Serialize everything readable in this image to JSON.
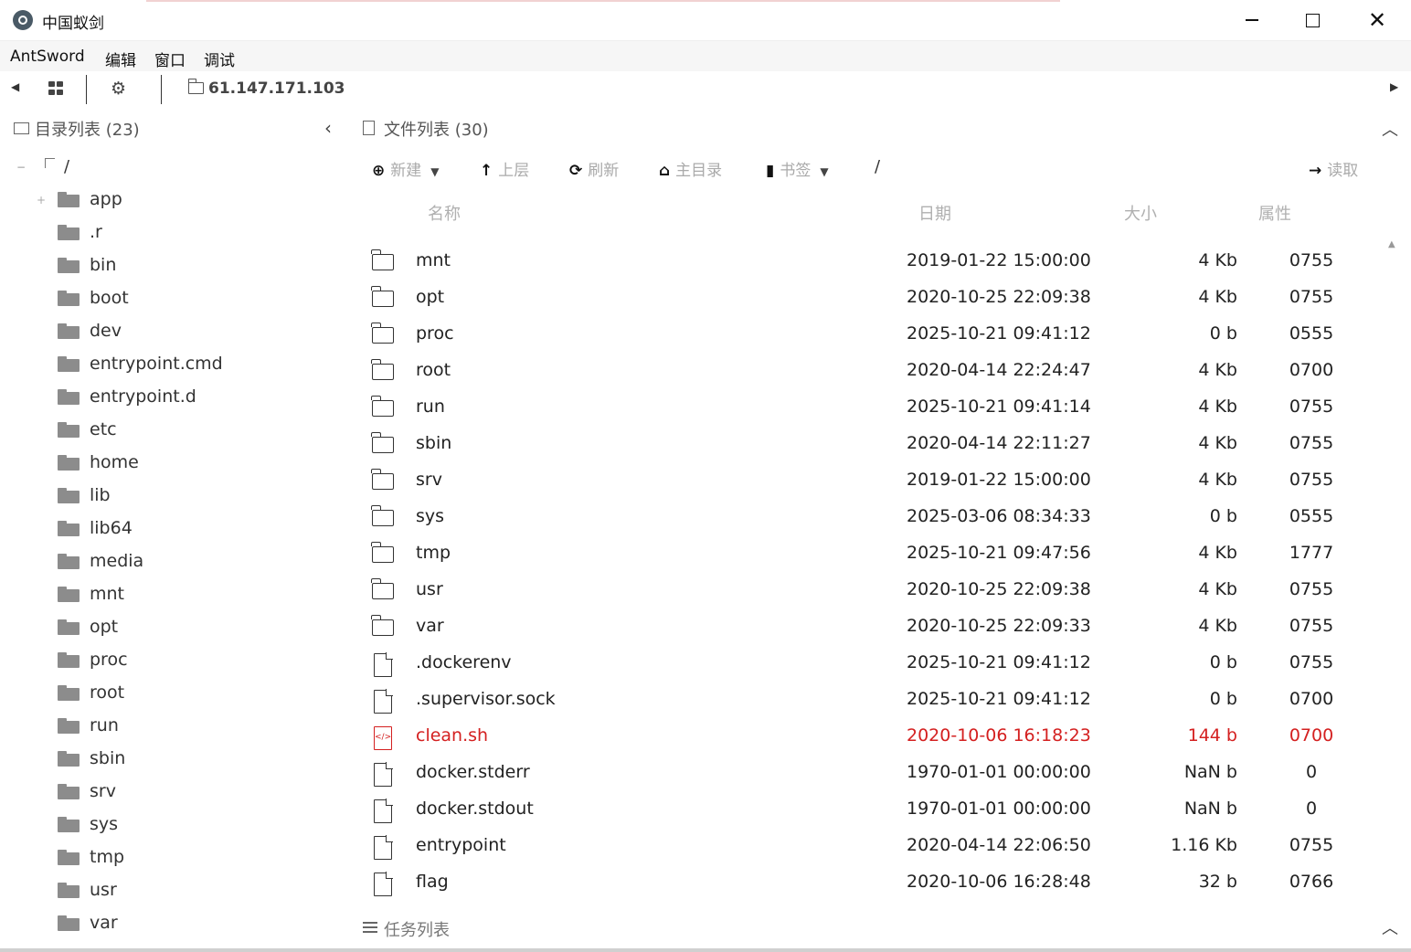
{
  "window": {
    "title": "中国蚁剑"
  },
  "menu": [
    "AntSword",
    "编辑",
    "窗口",
    "调试"
  ],
  "toolbar": {
    "tab_label": "61.147.171.103"
  },
  "left_panel": {
    "title": "目录列表 (23)",
    "root": "/",
    "items": [
      "app",
      ".r",
      "bin",
      "boot",
      "dev",
      "entrypoint.cmd",
      "entrypoint.d",
      "etc",
      "home",
      "lib",
      "lib64",
      "media",
      "mnt",
      "opt",
      "proc",
      "root",
      "run",
      "sbin",
      "srv",
      "sys",
      "tmp",
      "usr",
      "var"
    ]
  },
  "right_panel": {
    "title": "文件列表 (30)",
    "toolbar": {
      "new": "新建",
      "up": "上层",
      "refresh": "刷新",
      "home": "主目录",
      "bookmark": "书签",
      "path": "/",
      "read": "读取"
    },
    "columns": {
      "name": "名称",
      "date": "日期",
      "size": "大小",
      "attr": "属性"
    },
    "rows": [
      {
        "type": "folder",
        "name": "mnt",
        "date": "2019-01-22 15:00:00",
        "size": "4 Kb",
        "attr": "0755"
      },
      {
        "type": "folder",
        "name": "opt",
        "date": "2020-10-25 22:09:38",
        "size": "4 Kb",
        "attr": "0755"
      },
      {
        "type": "folder",
        "name": "proc",
        "date": "2025-10-21 09:41:12",
        "size": "0 b",
        "attr": "0555"
      },
      {
        "type": "folder",
        "name": "root",
        "date": "2020-04-14 22:24:47",
        "size": "4 Kb",
        "attr": "0700"
      },
      {
        "type": "folder",
        "name": "run",
        "date": "2025-10-21 09:41:14",
        "size": "4 Kb",
        "attr": "0755"
      },
      {
        "type": "folder",
        "name": "sbin",
        "date": "2020-04-14 22:11:27",
        "size": "4 Kb",
        "attr": "0755"
      },
      {
        "type": "folder",
        "name": "srv",
        "date": "2019-01-22 15:00:00",
        "size": "4 Kb",
        "attr": "0755"
      },
      {
        "type": "folder",
        "name": "sys",
        "date": "2025-03-06 08:34:33",
        "size": "0 b",
        "attr": "0555"
      },
      {
        "type": "folder",
        "name": "tmp",
        "date": "2025-10-21 09:47:56",
        "size": "4 Kb",
        "attr": "1777"
      },
      {
        "type": "folder",
        "name": "usr",
        "date": "2020-10-25 22:09:38",
        "size": "4 Kb",
        "attr": "0755"
      },
      {
        "type": "folder",
        "name": "var",
        "date": "2020-10-25 22:09:33",
        "size": "4 Kb",
        "attr": "0755"
      },
      {
        "type": "file",
        "name": ".dockerenv",
        "date": "2025-10-21 09:41:12",
        "size": "0 b",
        "attr": "0755"
      },
      {
        "type": "file",
        "name": ".supervisor.sock",
        "date": "2025-10-21 09:41:12",
        "size": "0 b",
        "attr": "0700"
      },
      {
        "type": "code",
        "name": "clean.sh",
        "date": "2020-10-06 16:18:23",
        "size": "144 b",
        "attr": "0700",
        "highlight": true
      },
      {
        "type": "file",
        "name": "docker.stderr",
        "date": "1970-01-01 00:00:00",
        "size": "NaN b",
        "attr": "0"
      },
      {
        "type": "file",
        "name": "docker.stdout",
        "date": "1970-01-01 00:00:00",
        "size": "NaN b",
        "attr": "0"
      },
      {
        "type": "file",
        "name": "entrypoint",
        "date": "2020-04-14 22:06:50",
        "size": "1.16 Kb",
        "attr": "0755"
      },
      {
        "type": "file",
        "name": "flag",
        "date": "2020-10-06 16:28:48",
        "size": "32 b",
        "attr": "0766"
      }
    ]
  },
  "task_panel": {
    "title": "任务列表"
  },
  "colors": {
    "highlight": "#d42020",
    "muted": "#aaaaaa"
  }
}
